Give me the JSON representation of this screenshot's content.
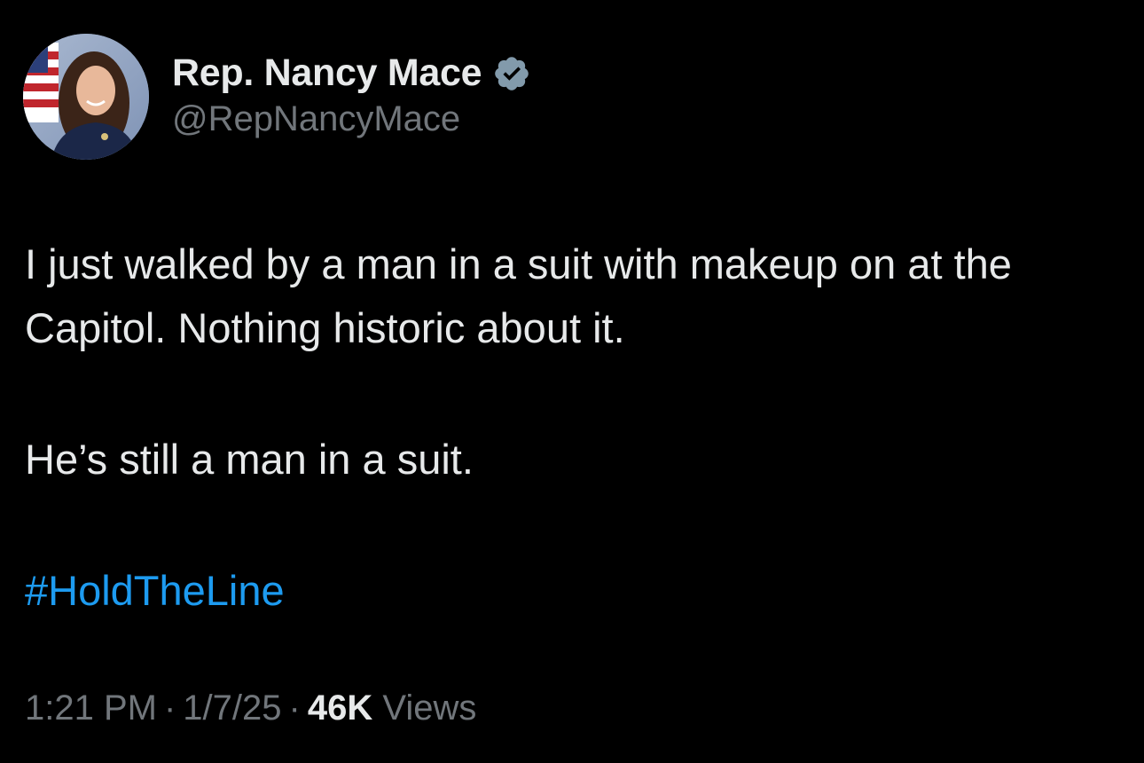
{
  "tweet": {
    "author": {
      "display_name": "Rep. Nancy Mace",
      "handle": "@RepNancyMace",
      "verified_icon": "verified-badge-icon",
      "avatar": "profile-photo"
    },
    "text": {
      "line1": "I just walked by a man in a suit with makeup on at the Capitol. Nothing historic about it.",
      "line2": "He’s still a man in a suit.",
      "hashtag": "#HoldTheLine"
    },
    "meta": {
      "time": "1:21 PM",
      "date": "1/7/25",
      "views_count": "46K",
      "views_label": "Views",
      "separator": "·"
    }
  },
  "colors": {
    "background": "#000000",
    "primary_text": "#e7e9ea",
    "secondary_text": "#71767b",
    "link": "#1d9bf0",
    "verified_badge": "#829aab"
  }
}
